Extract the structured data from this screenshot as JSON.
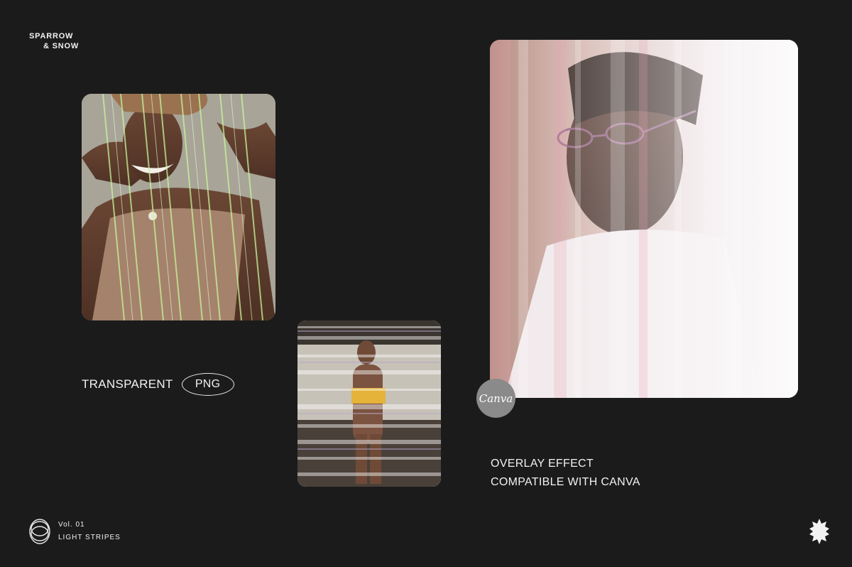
{
  "brand": {
    "line1": "SPARROW",
    "line2": "& SNOW"
  },
  "tagline_left": {
    "text": "TRANSPARENT",
    "pill": "PNG"
  },
  "canva_badge": "Canva",
  "overlay": {
    "line1": "OVERLAY EFFECT",
    "line2": "COMPATIBLE WITH CANVA"
  },
  "volume": {
    "number": "Vol. 01",
    "title": "LIGHT STRIPES"
  },
  "icons": {
    "rings": "concentric-rings-icon",
    "star": "starburst-icon"
  },
  "colors": {
    "background": "#1b1b1b",
    "text": "#f2f2f2",
    "badge": "#8a8a8a",
    "stripe_green": "#b9f08a"
  }
}
